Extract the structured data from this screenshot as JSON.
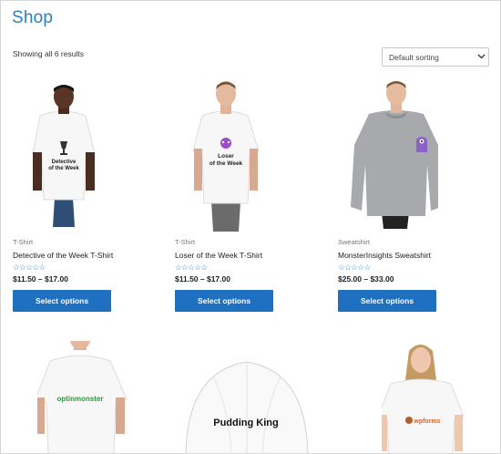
{
  "shop": {
    "title": "Shop",
    "result_count": "Showing all 6 results",
    "sorting": {
      "selected": "Default sorting",
      "icon": "chevron-down-icon"
    }
  },
  "products": [
    {
      "category": "T-Shirt",
      "name": "Detective of the Week T-Shirt",
      "stars": "☆☆☆☆☆",
      "price": "$11.50 – $17.00",
      "button": "Select options",
      "print_text": [
        "Detective",
        "of the Week"
      ]
    },
    {
      "category": "T-Shirt",
      "name": "Loser of the Week T-Shirt",
      "stars": "☆☆☆☆☆",
      "price": "$11.50 – $17.00",
      "button": "Select options",
      "print_text": [
        "Loser",
        "of the Week"
      ]
    },
    {
      "category": "Sweatshirt",
      "name": "MonsterInsights Sweatshirt",
      "stars": "☆☆☆☆☆",
      "price": "$25.00 – $33.00",
      "button": "Select options"
    },
    {
      "print_text": [
        "optinmonster"
      ]
    },
    {
      "print_text": [
        "Pudding King"
      ]
    },
    {
      "print_text": [
        "wpforms"
      ]
    }
  ],
  "colors": {
    "accent": "#2a7fc6",
    "button": "#1f70c1",
    "text": "#222222",
    "muted": "#777777",
    "sweatshirt": "#a7a9ac"
  }
}
